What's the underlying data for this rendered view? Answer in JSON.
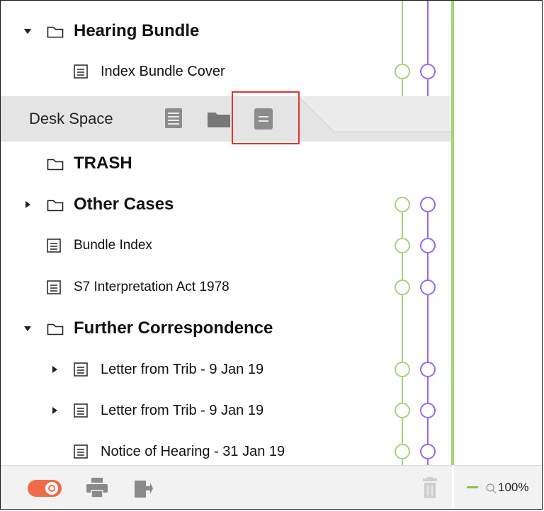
{
  "tree_top": [
    {
      "label": "Hearing Bundle",
      "type": "folder",
      "expanded": true,
      "bold": true
    },
    {
      "label": "Index Bundle Cover",
      "type": "document",
      "bold": false
    }
  ],
  "desk_space": {
    "label": "Desk Space",
    "tabs": [
      "list-view",
      "folder-view",
      "document-view"
    ],
    "active_tab": "document-view"
  },
  "tree_bottom": [
    {
      "label": "TRASH",
      "type": "folder",
      "bold": true
    },
    {
      "label": "Other Cases",
      "type": "folder",
      "collapsed": true,
      "bold": true
    },
    {
      "label": "Bundle Index",
      "type": "document"
    },
    {
      "label": "S7 Interpretation Act 1978",
      "type": "document"
    },
    {
      "label": "Further Correspondence",
      "type": "folder",
      "expanded": true,
      "bold": true
    },
    {
      "label": "Letter from Trib - 9 Jan 19",
      "type": "document",
      "collapsed": true
    },
    {
      "label": "Letter from Trib - 9 Jan 19",
      "type": "document",
      "collapsed": true
    },
    {
      "label": "Notice of Hearing - 31 Jan 19",
      "type": "document"
    }
  ],
  "footer": {
    "toggle_icon": "toggle-icon",
    "print_icon": "print-icon",
    "export_icon": "export-icon",
    "trash_icon": "trash-icon"
  },
  "right_footer": {
    "zoom_text": "100%"
  },
  "colors": {
    "accent_green": "#a6d27a",
    "accent_purple": "#9a66f0",
    "highlight_red": "#e0352b",
    "toggle_orange": "#ef6c4a"
  }
}
